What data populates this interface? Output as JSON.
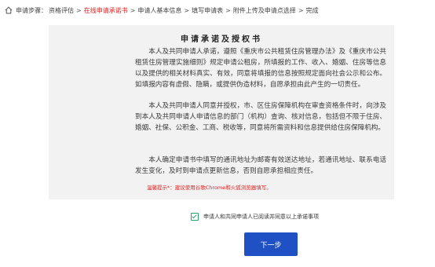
{
  "breadcrumb": {
    "prefix": "申请步骤：",
    "steps": [
      {
        "label": "资格评估",
        "active": false
      },
      {
        "label": "在线申请承诺书",
        "active": true
      },
      {
        "label": "申请人基本信息",
        "active": false
      },
      {
        "label": "填写申请表",
        "active": false
      },
      {
        "label": "附件上传及申请点选择",
        "active": false
      },
      {
        "label": "完成",
        "active": false
      }
    ],
    "separator": ">"
  },
  "commitment": {
    "title": "申请承诺及授权书",
    "paragraphs": [
      "本人及共同申请人承诺，遵照《重庆市公共租赁住房管理办法》及《重庆市公共租赁住房管理实施细则》规定申请公租房，所填报的工作、收入、婚姻、住房等信息以及提供的相关材料真实、有效，同意将填报的信息按照规定面向社会公示和公布。如填报内容有虚假、隐瞒，或提供伪造材料，自愿承担由此产生的一切责任。",
      "本人及共同申请人同意并授权，市、区住房保障机构在审查资格条件时，向涉及到本人及共同申请人申请信息的部门（机构）查询、核对信息，包括但不限于住房、婚姻、社保、公积金、工商、税收等，同意将所需资料和信息提供给住房保障机构。",
      "本人确定申请书中填写的通讯地址为邮寄有效送达地址，若通讯地址、联系电话发生变化，及时到申请点更新信息，否则自愿承担相应责任。"
    ],
    "tip": "温馨提示*：建议使用谷歌Chrome和火狐浏览器填写。"
  },
  "agreement": {
    "checked": true,
    "label": "申请人和共同申请人已阅读并同意以上承诺事项"
  },
  "next_button": {
    "label": "下一步"
  },
  "colors": {
    "accent": "#1f51c4",
    "active_step": "#e02020",
    "checkbox": "#2aa36b",
    "panel_bg": "#f2f2f2"
  }
}
